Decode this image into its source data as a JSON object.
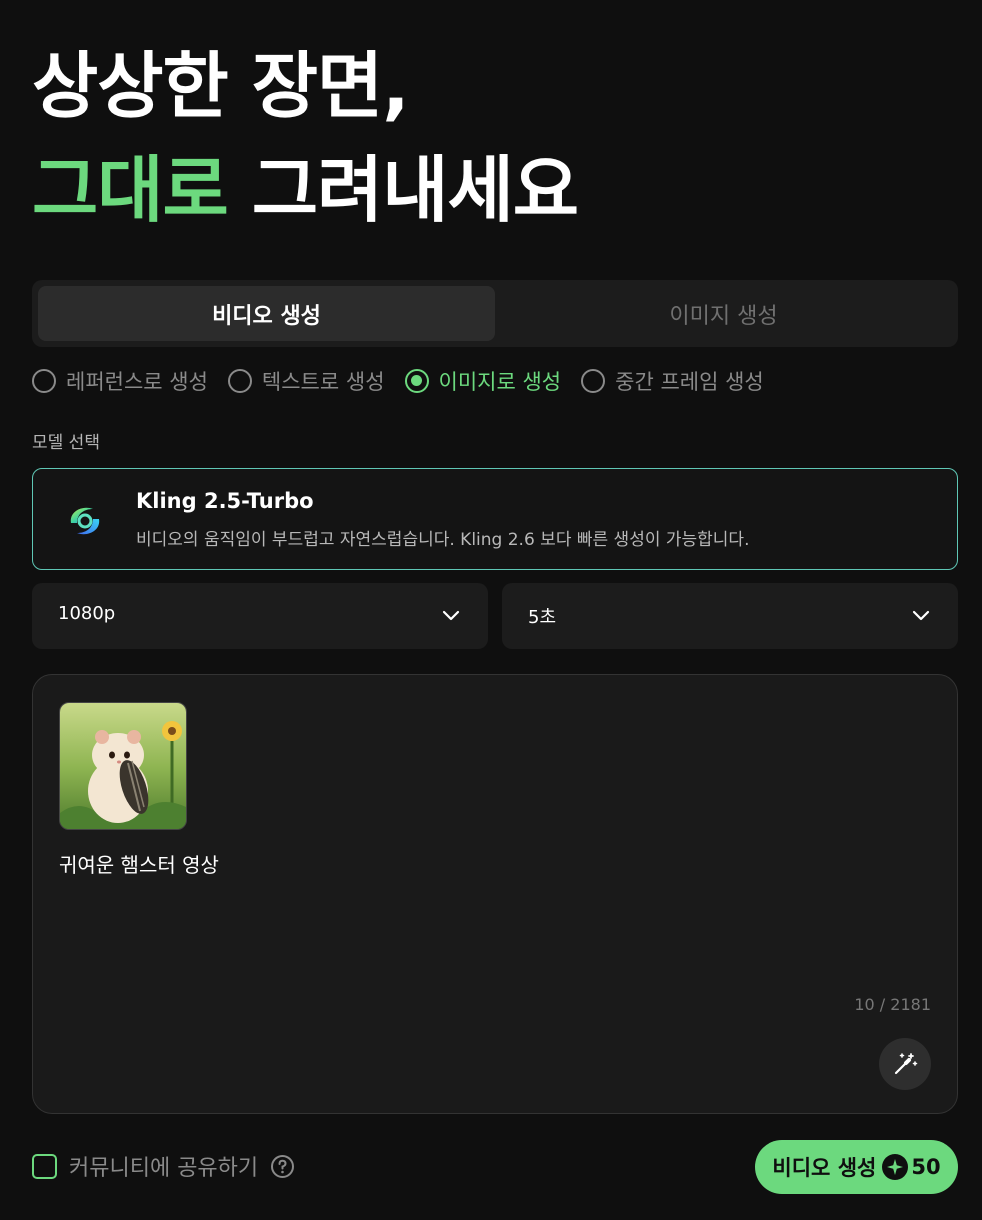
{
  "hero": {
    "line1": "상상한 장면,",
    "line2_accent": "그대로",
    "line2_rest": "그려내세요"
  },
  "tabs": [
    {
      "label": "비디오 생성",
      "active": true
    },
    {
      "label": "이미지 생성",
      "active": false
    }
  ],
  "modes": [
    {
      "label": "레퍼런스로 생성",
      "selected": false
    },
    {
      "label": "텍스트로 생성",
      "selected": false
    },
    {
      "label": "이미지로 생성",
      "selected": true
    },
    {
      "label": "중간 프레임 생성",
      "selected": false
    }
  ],
  "model": {
    "section_label": "모델 선택",
    "name": "Kling 2.5-Turbo",
    "description": "비디오의 움직임이 부드럽고 자연스럽습니다. Kling 2.6 보다 빠른 생성이 가능합니다.",
    "logo_icon": "kling-logo-icon"
  },
  "selects": {
    "resolution": "1080p",
    "duration": "5초"
  },
  "prompt": {
    "thumbnail_icon": "hamster-image",
    "text": "귀여운 햄스터 영상",
    "counter": "10 / 2181"
  },
  "share": {
    "label": "커뮤니티에 공유하기"
  },
  "generate": {
    "label": "비디오 생성",
    "cost": "50"
  },
  "colors": {
    "accent": "#6cd97e",
    "background": "#0f0f0f",
    "card_border": "#5fc7b5"
  }
}
